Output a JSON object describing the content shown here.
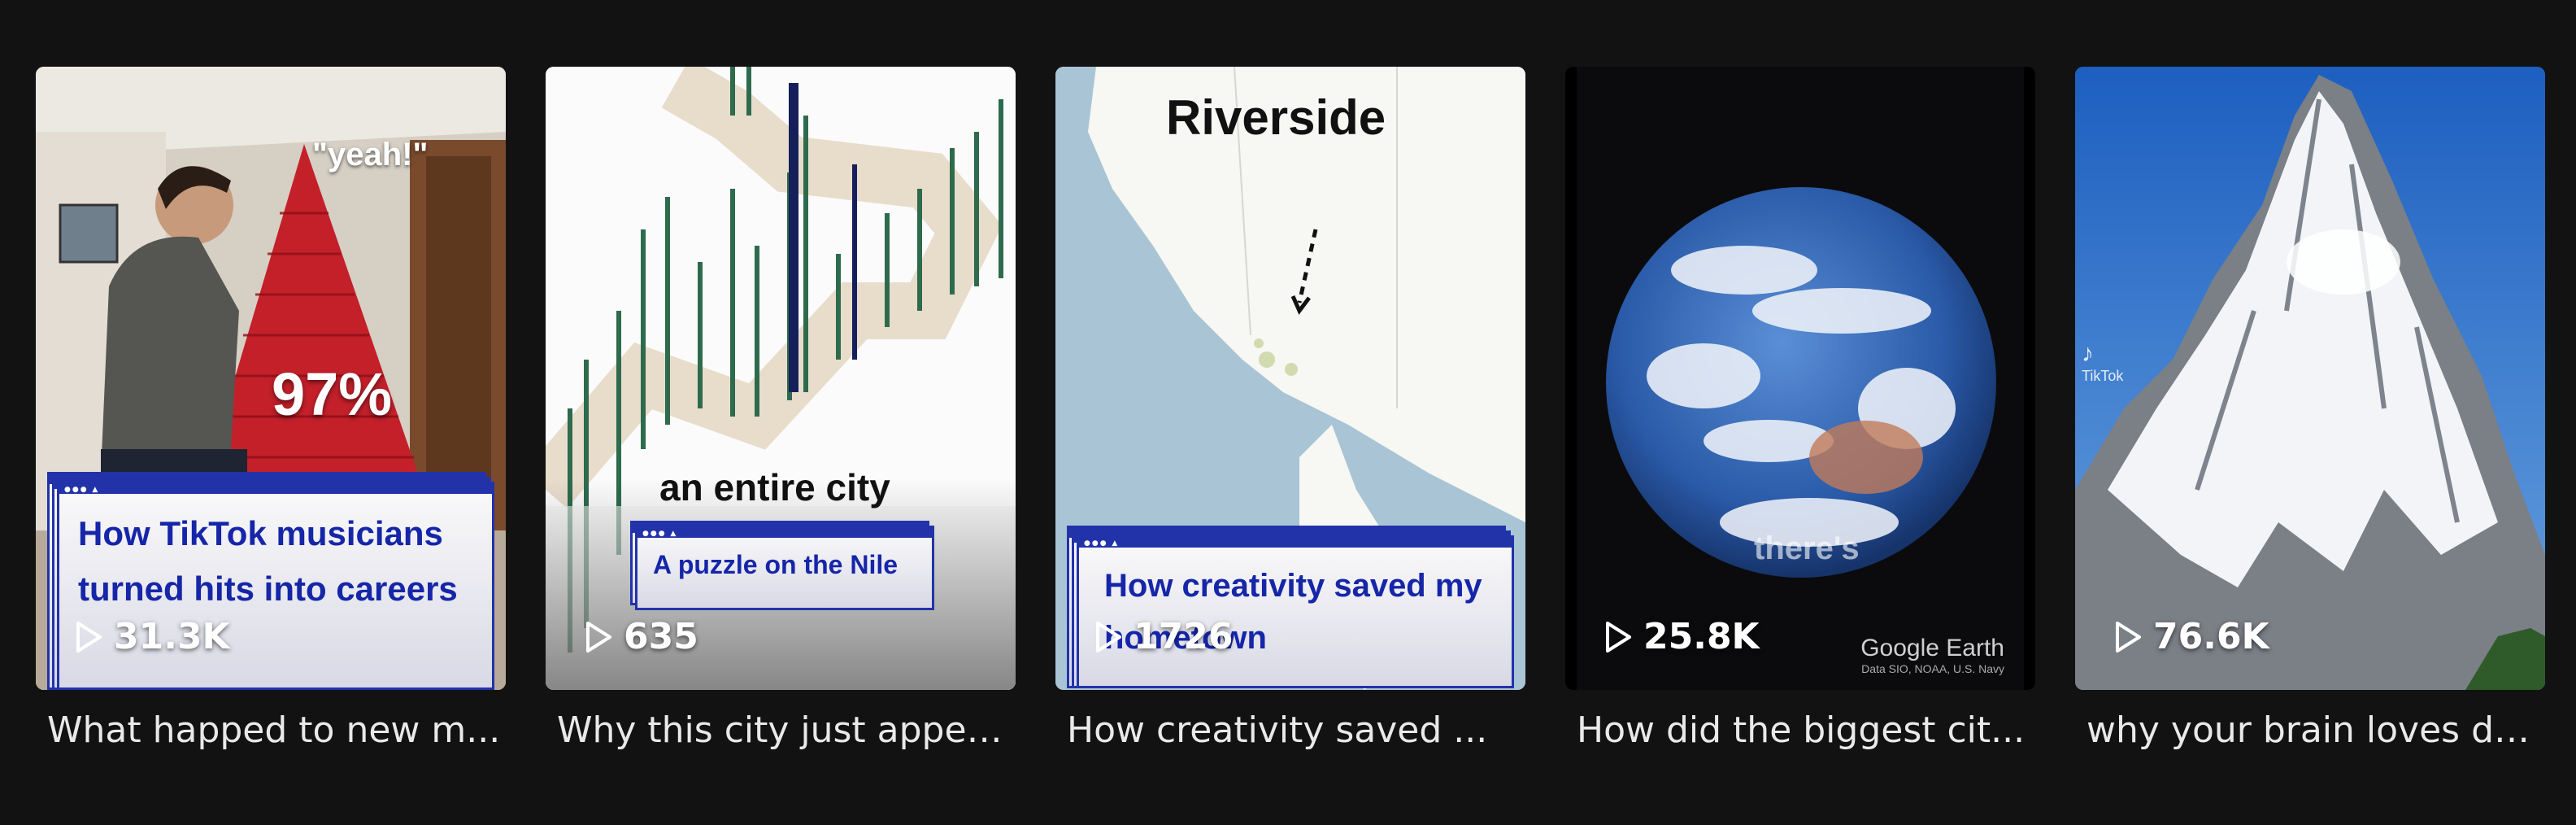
{
  "videos": [
    {
      "caption": "What happed to new m...",
      "views": "31.3K",
      "overlay_percent": "97%",
      "overlay_quote": "\"yeah!\"",
      "title_card": "How TikTok musicians turned hits into careers"
    },
    {
      "caption": "Why this city just appea...",
      "views": "635",
      "overlay_text": "an entire city",
      "title_card": "A puzzle on the Nile"
    },
    {
      "caption": "How creativity saved ...",
      "views": "1726",
      "overlay_title": "Riverside",
      "title_card": "How creativity saved my hometown"
    },
    {
      "caption": "How did the biggest cit...",
      "views": "25.8K",
      "overlay_subtitle": "there's",
      "watermark": "Google Earth",
      "watermark_credit": "Data SIO, NOAA, U.S. Navy"
    },
    {
      "caption": "why your brain loves da...",
      "views": "76.6K",
      "watermark": "TikTok"
    }
  ],
  "icons": {
    "play": "play-icon"
  },
  "colors": {
    "background": "#121212",
    "title_card_blue": "#1626a8"
  }
}
